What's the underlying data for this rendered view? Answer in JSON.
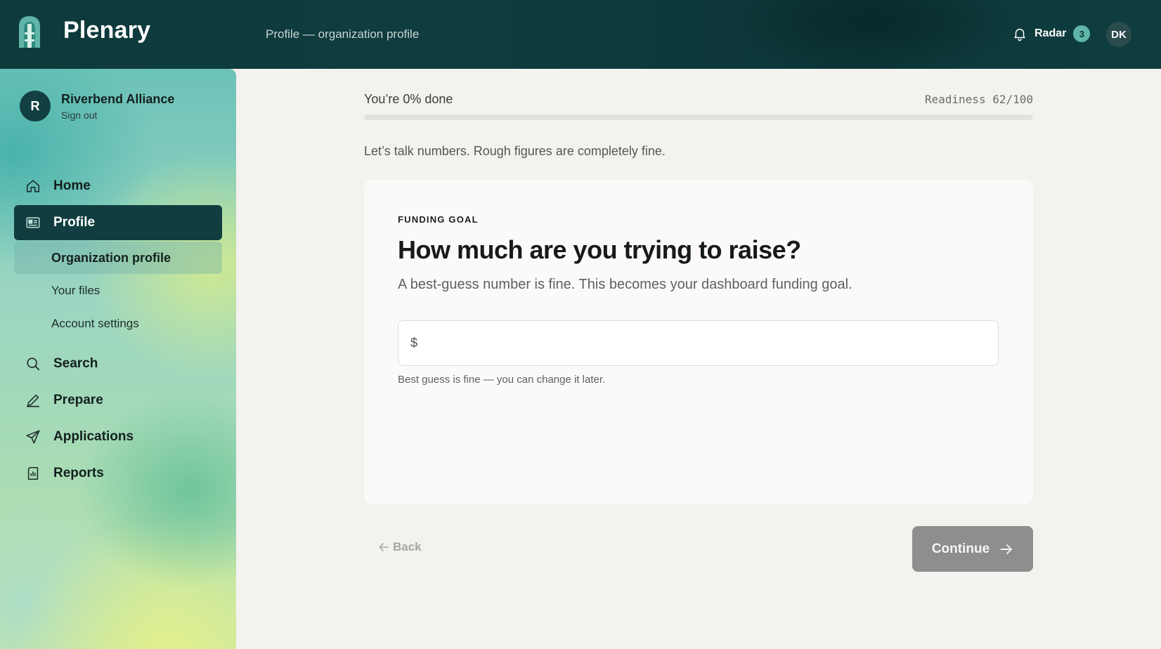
{
  "header": {
    "brand": "Plenary",
    "breadcrumb": "Profile — organization profile",
    "radar_label": "Radar",
    "radar_count": "3",
    "user_initials": "DK"
  },
  "sidebar": {
    "org_initial": "R",
    "org_name": "Riverbend Alliance",
    "sign_out": "Sign out",
    "items": [
      {
        "label": "Home",
        "icon": "home-icon"
      },
      {
        "label": "Profile",
        "icon": "id-card-icon",
        "active": true
      },
      {
        "label": "Search",
        "icon": "search-icon"
      },
      {
        "label": "Prepare",
        "icon": "pencil-icon"
      },
      {
        "label": "Applications",
        "icon": "send-icon"
      },
      {
        "label": "Reports",
        "icon": "report-icon"
      }
    ],
    "sub_items": [
      {
        "label": "Organization profile",
        "active": true
      },
      {
        "label": "Your files"
      },
      {
        "label": "Account settings"
      }
    ]
  },
  "progress": {
    "done_label": "You’re 0% done",
    "percent": 0,
    "readiness": "Readiness 62/100"
  },
  "intro": "Let’s talk numbers. Rough figures are completely fine.",
  "card": {
    "eyebrow": "FUNDING GOAL",
    "question": "How much are you trying to raise?",
    "help": "A best-guess number is fine. This becomes your dashboard funding goal.",
    "currency_symbol": "$",
    "input_value": "",
    "hint": "Best guess is fine — you can change it later."
  },
  "footer": {
    "back_label": "Back",
    "continue_label": "Continue"
  },
  "colors": {
    "header_bg": "#0f3c3e",
    "accent": "#113d40",
    "badge": "#5fb5a7",
    "continue_disabled": "#8c8f8e"
  }
}
